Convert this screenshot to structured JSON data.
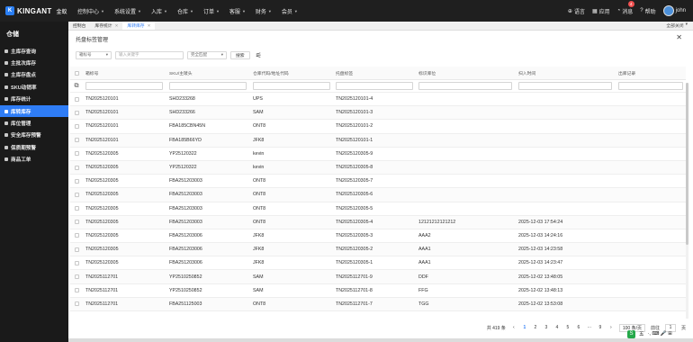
{
  "app": {
    "logo_text": "KINGANT",
    "logo_sub": "金蚁"
  },
  "topnav": [
    {
      "label": "控制中心",
      "caret": true
    },
    {
      "label": "系统设置",
      "caret": true
    },
    {
      "label": "入库",
      "caret": true
    },
    {
      "label": "仓库",
      "caret": true
    },
    {
      "label": "订单",
      "caret": true
    },
    {
      "label": "客服",
      "caret": true
    },
    {
      "label": "财务",
      "caret": true
    },
    {
      "label": "会员",
      "caret": true
    }
  ],
  "topright": {
    "language": "语言",
    "apps": "应用",
    "messages": "消息",
    "message_count": "4",
    "help": "帮助",
    "user": "john"
  },
  "sidebar": {
    "title": "仓储",
    "items": [
      {
        "label": "主库存查询",
        "active": false
      },
      {
        "label": "主批次库存",
        "active": false
      },
      {
        "label": "主库存盘点",
        "active": false
      },
      {
        "label": "SKU动销率",
        "active": false
      },
      {
        "label": "库存统计",
        "active": false
      },
      {
        "label": "库转库存",
        "active": true
      },
      {
        "label": "库位管理",
        "active": false
      },
      {
        "label": "安全库存预警",
        "active": false
      },
      {
        "label": "保质期预警",
        "active": false
      },
      {
        "label": "商品工单",
        "active": false
      }
    ]
  },
  "tabs": [
    {
      "label": "控制台",
      "closable": false,
      "active": false
    },
    {
      "label": "库存统计",
      "closable": true,
      "active": false
    },
    {
      "label": "库转库存",
      "closable": true,
      "active": true
    }
  ],
  "close_all": "全部关闭",
  "panel": {
    "title": "托盘标签管理"
  },
  "filters": {
    "field_select": "箱标号",
    "keyword_placeholder": "输入关键字",
    "match_select": "完全匹配",
    "search_button": "搜索"
  },
  "table": {
    "headers": [
      "箱标号",
      "SKU/主唛头",
      "仓库代码/地址代码",
      "托盘标签",
      "标识库位",
      "扫入时间",
      "出库记录"
    ],
    "rows": [
      [
        "TN2025120101",
        "SHD233268",
        "UPS",
        "TN2025120101-4",
        "",
        "",
        ""
      ],
      [
        "TN2025120101",
        "SHD233266",
        "SAM",
        "TN2025120101-3",
        "",
        "",
        ""
      ],
      [
        "TN2025120101",
        "FBA185CBN45N",
        "ONT8",
        "TN2025120101-2",
        "",
        "",
        ""
      ],
      [
        "TN2025120101",
        "FBA185B66YD",
        "JFK8",
        "TN2025120101-1",
        "",
        "",
        ""
      ],
      [
        "TN2025120305",
        "YP25120322",
        "kevin",
        "TN2025120305-9",
        "",
        "",
        ""
      ],
      [
        "TN2025120305",
        "YP25120322",
        "kevin",
        "TN2025120305-8",
        "",
        "",
        ""
      ],
      [
        "TN2025120305",
        "FBA251203003",
        "ONT8",
        "TN2025120305-7",
        "",
        "",
        ""
      ],
      [
        "TN2025120305",
        "FBA251203003",
        "ONT8",
        "TN2025120305-6",
        "",
        "",
        ""
      ],
      [
        "TN2025120305",
        "FBA251203003",
        "ONT8",
        "TN2025120305-5",
        "",
        "",
        ""
      ],
      [
        "TN2025120305",
        "FBA251203003",
        "ONT8",
        "TN2025120305-4",
        "12121212121212",
        "2025-12-03 17:54:24",
        ""
      ],
      [
        "TN2025120305",
        "FBA251203006",
        "JFK8",
        "TN2025120305-3",
        "AAA2",
        "2025-12-03 14:24:16",
        ""
      ],
      [
        "TN2025120305",
        "FBA251203006",
        "JFK8",
        "TN2025120305-2",
        "AAA1",
        "2025-12-03 14:23:58",
        ""
      ],
      [
        "TN2025120305",
        "FBA251203006",
        "JFK8",
        "TN2025120305-1",
        "AAA1",
        "2025-12-03 14:23:47",
        ""
      ],
      [
        "TN2025112701",
        "YP2510250852",
        "SAM",
        "TN2025112701-9",
        "DDF",
        "2025-12-02 13:48:05",
        ""
      ],
      [
        "TN2025112701",
        "YP2510250852",
        "SAM",
        "TN2025112701-8",
        "FFG",
        "2025-12-02 13:48:13",
        ""
      ],
      [
        "TN2025112701",
        "FBA251125003",
        "ONT8",
        "TN2025112701-7",
        "TGG",
        "2025-12-02 13:53:08",
        ""
      ]
    ]
  },
  "pager": {
    "total": "共 419 条",
    "prev": "‹",
    "pages": [
      "1",
      "2",
      "3",
      "4",
      "5",
      "6"
    ],
    "ellipsis": "···",
    "last": "9",
    "next": "›",
    "page_size": "100 条/页",
    "jump_label": "前往",
    "jump_value": "1",
    "page_unit": "页"
  },
  "tray": {
    "label": "五",
    "extra": "·, ⌨ 🎤 ⊞"
  },
  "colors": {
    "accent": "#2f7df6",
    "topbar": "#1f1f1f",
    "sidebar": "#1a1a1a"
  }
}
